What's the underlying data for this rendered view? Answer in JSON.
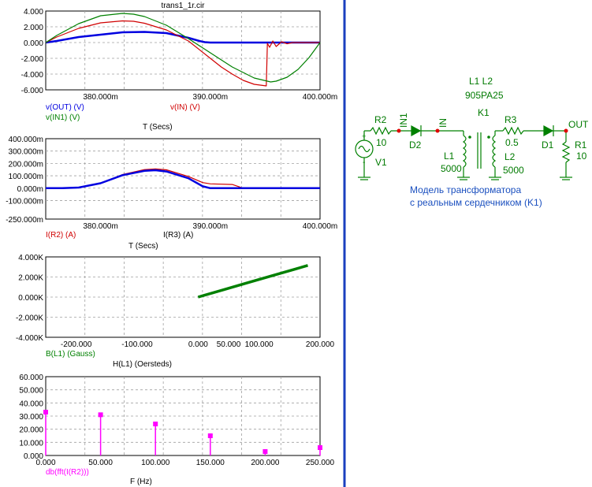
{
  "window_title": "trans1_1r.cir",
  "colors": {
    "blue": "#0000e0",
    "red": "#d00000",
    "green": "#008000",
    "magenta": "#ff00ff",
    "divider": "#1a3fbf",
    "grid": "#a0a0a0",
    "schematic": "#008000",
    "schematic_labels": "#1a4fbf",
    "node_dot": "#e00000"
  },
  "chart_data": [
    {
      "id": "transient-voltage",
      "type": "line",
      "title": "trans1_1r.cir",
      "xlabel": "T (Secs)",
      "xlim": [
        375,
        400
      ],
      "ylim": [
        -6,
        4
      ],
      "x_ticks": [
        "380.000m",
        "390.000m",
        "400.000m"
      ],
      "x_tick_values": [
        380,
        390,
        400
      ],
      "y_ticks": [
        "4.000",
        "2.000",
        "0.000",
        "-2.000",
        "-4.000",
        "-6.000"
      ],
      "y_tick_values": [
        4,
        2,
        0,
        -2,
        -4,
        -6
      ],
      "legend": [
        "v(OUT) (V)",
        "v(IN) (V)",
        "v(IN1) (V)"
      ],
      "grid": true,
      "series": [
        {
          "name": "v(OUT) (V)",
          "color": "#0000e0",
          "width": 2.5,
          "x": [
            375,
            376,
            378,
            380,
            382,
            384,
            386,
            388,
            389,
            389.5,
            390,
            392,
            394,
            396,
            398,
            400
          ],
          "y": [
            0,
            0.2,
            0.7,
            1.0,
            1.3,
            1.35,
            1.2,
            0.6,
            0.2,
            0.05,
            0,
            0,
            0,
            0,
            0,
            0
          ]
        },
        {
          "name": "v(IN) (V)",
          "color": "#d00000",
          "width": 1.2,
          "x": [
            375,
            376,
            378,
            380,
            382,
            383,
            384,
            386,
            388,
            390,
            391,
            392,
            393,
            394,
            395.1,
            395.2,
            395.4,
            395.7,
            396,
            396.5,
            397,
            397.5,
            400
          ],
          "y": [
            0,
            0.7,
            1.8,
            2.5,
            2.75,
            2.7,
            2.45,
            1.6,
            0.2,
            -2.0,
            -3.1,
            -4.0,
            -4.8,
            -5.3,
            -5.5,
            -0.1,
            -0.6,
            0.2,
            -0.5,
            0.1,
            -0.15,
            0,
            0
          ]
        },
        {
          "name": "v(IN1) (V)",
          "color": "#008000",
          "width": 1.2,
          "x": [
            375,
            376,
            378,
            380,
            382,
            383,
            384,
            386,
            388,
            390,
            392,
            394,
            395.5,
            396,
            397,
            398,
            399,
            400
          ],
          "y": [
            0,
            0.9,
            2.4,
            3.4,
            3.7,
            3.6,
            3.3,
            2.2,
            0.5,
            -1.3,
            -3.1,
            -4.5,
            -5.0,
            -4.9,
            -4.4,
            -3.4,
            -1.9,
            0
          ]
        }
      ]
    },
    {
      "id": "transient-current",
      "type": "line",
      "xlabel": "T (Secs)",
      "xlim": [
        375,
        400
      ],
      "ylim": [
        -250,
        400
      ],
      "x_ticks": [
        "380.000m",
        "390.000m",
        "400.000m"
      ],
      "x_tick_values": [
        380,
        390,
        400
      ],
      "y_ticks": [
        "400.000m",
        "300.000m",
        "200.000m",
        "100.000m",
        "0.000m",
        "-100.000m",
        "-250.000m"
      ],
      "y_tick_values": [
        400,
        300,
        200,
        100,
        0,
        -100,
        -250
      ],
      "legend": [
        "I(R2) (A)",
        "I(R3) (A)"
      ],
      "grid": true,
      "series": [
        {
          "name": "I(R2) (A)",
          "color": "#d00000",
          "width": 1.2,
          "x": [
            375,
            376.5,
            378,
            380,
            382,
            384,
            385,
            386,
            388,
            389.3,
            390,
            392,
            393,
            394,
            400
          ],
          "y": [
            0,
            0,
            5,
            40,
            110,
            150,
            155,
            148,
            95,
            45,
            35,
            30,
            0,
            0,
            0
          ]
        },
        {
          "name": "I(R3) (A)",
          "color": "#0000e0",
          "width": 2.5,
          "x": [
            375,
            376.5,
            378,
            380,
            382,
            384,
            385,
            386,
            388,
            389.3,
            390,
            392,
            394,
            400
          ],
          "y": [
            0,
            0,
            5,
            40,
            105,
            140,
            145,
            135,
            80,
            15,
            0,
            0,
            0,
            0
          ]
        }
      ]
    },
    {
      "id": "bh-curve",
      "type": "line",
      "xlabel": "H(L1) (Oersteds)",
      "xlim": [
        -250,
        200
      ],
      "ylim": [
        -4000,
        4000
      ],
      "x_ticks": [
        "-200.000",
        "-100.000",
        "0.000",
        "50.000",
        "100.000",
        "200.000"
      ],
      "x_tick_values": [
        -200,
        -100,
        0,
        50,
        100,
        200
      ],
      "y_ticks": [
        "4.000K",
        "2.000K",
        "0.000K",
        "-2.000K",
        "-4.000K"
      ],
      "y_tick_values": [
        4000,
        2000,
        0,
        -2000,
        -4000
      ],
      "legend": [
        "B(L1) (Gauss)"
      ],
      "grid": true,
      "series": [
        {
          "name": "B(L1) (Gauss)",
          "color": "#008000",
          "width": 3.5,
          "x": [
            0,
            40,
            80,
            120,
            160,
            180
          ],
          "y": [
            0,
            700,
            1400,
            2100,
            2800,
            3150
          ]
        }
      ]
    },
    {
      "id": "fft-spectrum",
      "type": "bar",
      "xlabel": "F (Hz)",
      "xlim": [
        0,
        250
      ],
      "ylim": [
        0,
        60
      ],
      "x_ticks": [
        "0.000",
        "50.000",
        "100.000",
        "150.000",
        "200.000",
        "250.000"
      ],
      "x_tick_values": [
        0,
        50,
        100,
        150,
        200,
        250
      ],
      "y_ticks": [
        "60.000",
        "50.000",
        "40.000",
        "30.000",
        "20.000",
        "10.000",
        "0.000"
      ],
      "y_tick_values": [
        60,
        50,
        40,
        30,
        20,
        10,
        0
      ],
      "legend": [
        "db(fft(I(R2)))"
      ],
      "grid": true,
      "series": [
        {
          "name": "db(fft(I(R2)))",
          "color": "#ff00ff",
          "x": [
            0,
            50,
            100,
            150,
            200,
            250
          ],
          "y": [
            33,
            31,
            24,
            15,
            3,
            6
          ]
        }
      ]
    }
  ],
  "schematic": {
    "components": [
      {
        "ref": "R2",
        "value": "10"
      },
      {
        "ref": "V1",
        "value": ""
      },
      {
        "ref": "D2",
        "value": ""
      },
      {
        "ref": "L1",
        "value": "5000"
      },
      {
        "ref": "L2",
        "value": "5000"
      },
      {
        "ref": "K1",
        "value": "L1 L2 905PA25"
      },
      {
        "ref": "R3",
        "value": "0.5"
      },
      {
        "ref": "D1",
        "value": ""
      },
      {
        "ref": "R1",
        "value": "10"
      }
    ],
    "labels": {
      "k1_line1": "L1 L2",
      "k1_line2": "905PA25",
      "k1_ref": "K1",
      "r2_ref": "R2",
      "r2_val": "10",
      "v1_ref": "V1",
      "d2_ref": "D2",
      "l1_ref": "L1",
      "l1_val": "5000",
      "l2_ref": "L2",
      "l2_val": "5000",
      "r3_ref": "R3",
      "r3_val": "0.5",
      "d1_ref": "D1",
      "r1_ref": "R1",
      "r1_val": "10",
      "node_in1": "IN1",
      "node_in": "IN",
      "node_out": "OUT",
      "plus": "+",
      "minus": "-",
      "caption_line1": "Модель трансформатора",
      "caption_line2": "с реальным сердечником (K1)"
    }
  }
}
